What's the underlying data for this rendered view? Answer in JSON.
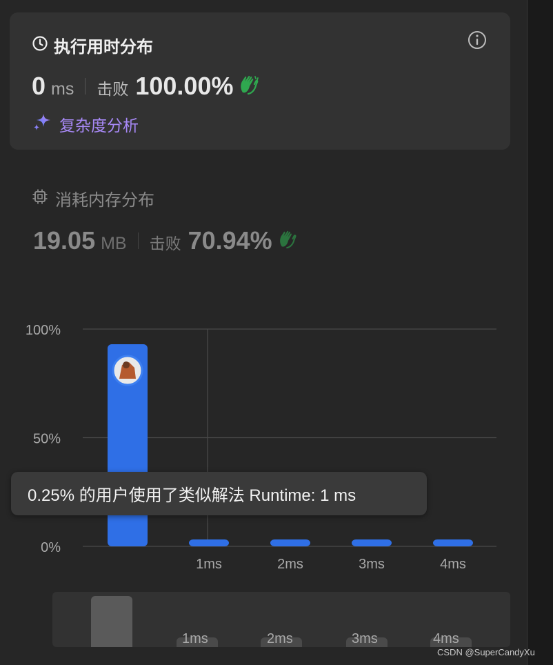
{
  "runtime": {
    "title": "执行用时分布",
    "value": "0",
    "unit": "ms",
    "beat_label": "击败",
    "beat_value": "100.00%",
    "complexity_link": "复杂度分析"
  },
  "memory": {
    "title": "消耗内存分布",
    "value": "19.05",
    "unit": "MB",
    "beat_label": "击败",
    "beat_value": "70.94%"
  },
  "tooltip": "0.25% 的用户使用了类似解法 Runtime: 1 ms",
  "mini_chart": {
    "ticks": [
      "1ms",
      "2ms",
      "3ms",
      "4ms"
    ]
  },
  "watermark": "CSDN @SuperCandyXu",
  "colors": {
    "bar": "#2f6fe6",
    "complexity": "#a889f7",
    "clap": "#2fa84f"
  },
  "chart_data": {
    "type": "bar",
    "categories": [
      "0ms",
      "1ms",
      "2ms",
      "3ms",
      "4ms"
    ],
    "x_tick_labels": [
      "1ms",
      "2ms",
      "3ms",
      "4ms"
    ],
    "values": [
      93,
      0.25,
      0.25,
      0.25,
      0.25
    ],
    "y_ticks": [
      "100%",
      "50%",
      "0%"
    ],
    "ylim": [
      0,
      100
    ],
    "grid": true,
    "highlight_category": "0ms"
  }
}
